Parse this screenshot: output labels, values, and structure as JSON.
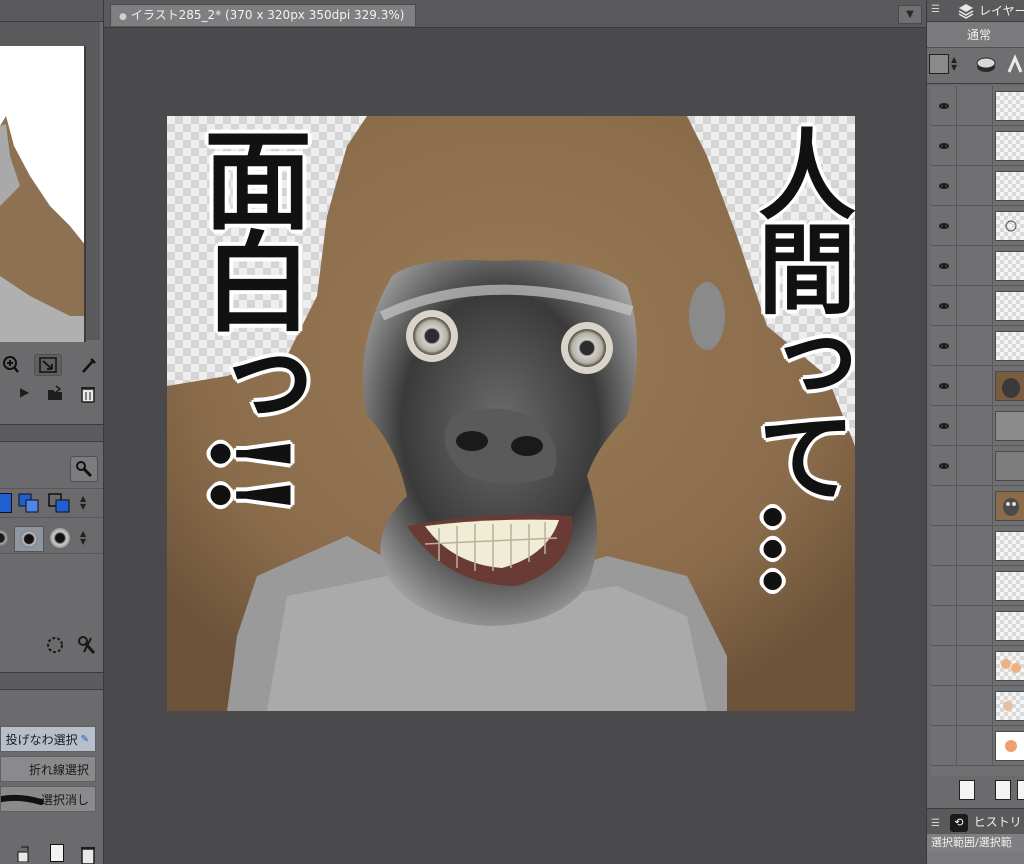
{
  "canvas": {
    "tab_title": "イラスト285_2* (370 x 320px 350dpi 329.3%)"
  },
  "artwork": {
    "left_text": "面白っ!!",
    "right_text": "人間って…"
  },
  "left_panel": {
    "tools": [
      {
        "label": "投げなわ選択",
        "active": true
      },
      {
        "label": "折れ線選択",
        "active": false
      },
      {
        "label": "選択消し",
        "active": false
      }
    ]
  },
  "layers_panel": {
    "title": "レイヤー",
    "blend_mode": "通常",
    "layers": [
      {
        "visible": true
      },
      {
        "visible": true
      },
      {
        "visible": true
      },
      {
        "visible": true
      },
      {
        "visible": true
      },
      {
        "visible": true
      },
      {
        "visible": true
      },
      {
        "visible": true
      },
      {
        "visible": true
      },
      {
        "visible": true
      },
      {
        "visible": false
      },
      {
        "visible": false
      },
      {
        "visible": false
      },
      {
        "visible": false
      },
      {
        "visible": false
      },
      {
        "visible": false
      },
      {
        "visible": false
      }
    ]
  },
  "history_panel": {
    "title": "ヒストリ",
    "items": [
      "選択範囲/選択範"
    ]
  },
  "colors": {
    "accent": "#1f5fcf",
    "panel": "#6b6b6d",
    "canvas_bg": "#4a4a4c"
  }
}
